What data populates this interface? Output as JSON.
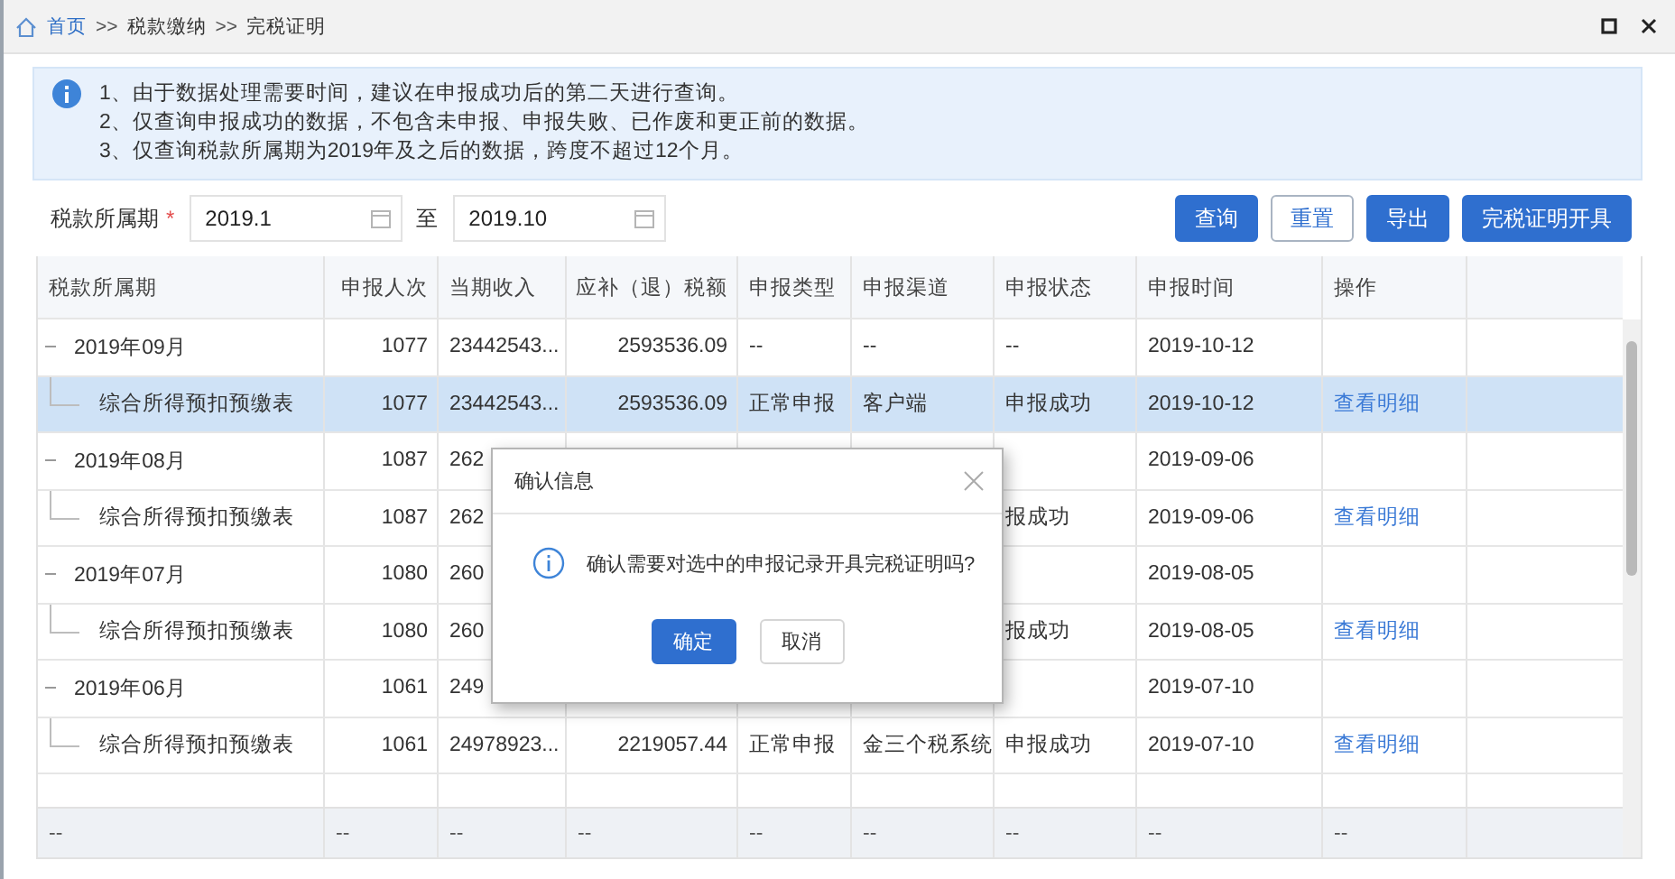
{
  "breadcrumb": [
    {
      "label": "首页",
      "kind": "link"
    },
    {
      "label": ">>",
      "kind": "separator"
    },
    {
      "label": "税款缴纳",
      "kind": "text"
    },
    {
      "label": ">>",
      "kind": "separator"
    },
    {
      "label": "完税证明",
      "kind": "text"
    }
  ],
  "notice": [
    "1、由于数据处理需要时间，建议在申报成功后的第二天进行查询。",
    "2、仅查询申报成功的数据，不包含未申报、申报失败、已作废和更正前的数据。",
    "3、仅查询税款所属期为2019年及之后的数据，跨度不超过12个月。"
  ],
  "filter": {
    "label": "税款所属期",
    "required_mark": "*",
    "from": "2019.1",
    "between": "至",
    "to": "2019.10"
  },
  "buttons": [
    {
      "label": "查询",
      "kind": "primary"
    },
    {
      "label": "重置",
      "kind": "outline"
    },
    {
      "label": "导出",
      "kind": "primary"
    },
    {
      "label": "完税证明开具",
      "kind": "primary"
    }
  ],
  "table": {
    "columns": [
      "税款所属期",
      "申报人次",
      "当期收入",
      "应补（退）税额",
      "申报类型",
      "申报渠道",
      "申报状态",
      "申报时间",
      "操作"
    ],
    "rows": [
      {
        "kind": "group",
        "expanded": true,
        "selected": false,
        "cells": [
          "2019年09月",
          "1077",
          "23442543...",
          "2593536.09",
          "--",
          "--",
          "--",
          "2019-10-12",
          null
        ]
      },
      {
        "kind": "item",
        "selected": true,
        "cells": [
          "综合所得预扣预缴表",
          "1077",
          "23442543...",
          "2593536.09",
          "正常申报",
          "客户端",
          "申报成功",
          "2019-10-12",
          "查看明细"
        ]
      },
      {
        "kind": "group",
        "expanded": true,
        "selected": false,
        "cells": [
          "2019年08月",
          "1087",
          "262",
          null,
          null,
          null,
          null,
          "2019-09-06",
          null
        ]
      },
      {
        "kind": "item",
        "selected": false,
        "cells": [
          "综合所得预扣预缴表",
          "1087",
          "262",
          null,
          null,
          null,
          "报成功",
          "2019-09-06",
          "查看明细"
        ]
      },
      {
        "kind": "group",
        "expanded": true,
        "selected": false,
        "cells": [
          "2019年07月",
          "1080",
          "260",
          null,
          null,
          null,
          null,
          "2019-08-05",
          null
        ]
      },
      {
        "kind": "item",
        "selected": false,
        "cells": [
          "综合所得预扣预缴表",
          "1080",
          "260",
          null,
          null,
          null,
          "报成功",
          "2019-08-05",
          "查看明细"
        ]
      },
      {
        "kind": "group",
        "expanded": true,
        "selected": false,
        "cells": [
          "2019年06月",
          "1061",
          "249",
          null,
          null,
          null,
          null,
          "2019-07-10",
          null
        ]
      },
      {
        "kind": "item",
        "selected": false,
        "cells": [
          "综合所得预扣预缴表",
          "1061",
          "24978923...",
          "2219057.44",
          "正常申报",
          "金三个税系统",
          "申报成功",
          "2019-07-10",
          "查看明细"
        ]
      }
    ],
    "summary": [
      "--",
      "--",
      "--",
      "--",
      "--",
      "--",
      "--",
      "--",
      "--"
    ]
  },
  "dialog": {
    "title": "确认信息",
    "message": "确认需要对选中的申报记录开具完税证明吗?",
    "buttons": [
      {
        "label": "确定",
        "kind": "primary"
      },
      {
        "label": "取消",
        "kind": "plain"
      }
    ]
  }
}
